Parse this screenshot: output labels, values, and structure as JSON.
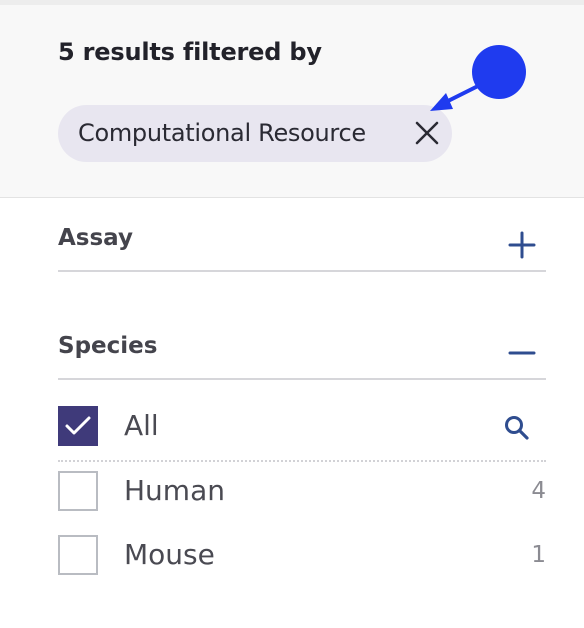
{
  "results_heading": "5 results filtered by",
  "active_filter": {
    "label": "Computational Resource",
    "remove_icon": "close-icon"
  },
  "annotation_color": "#1f3bef",
  "facets": {
    "assay": {
      "title": "Assay",
      "toggle_icon": "plus-icon",
      "expanded": false
    },
    "species": {
      "title": "Species",
      "toggle_icon": "minus-icon",
      "expanded": true,
      "search_icon": "search-icon",
      "options": [
        {
          "label": "All",
          "checked": true,
          "count": ""
        },
        {
          "label": "Human",
          "checked": false,
          "count": "4"
        },
        {
          "label": "Mouse",
          "checked": false,
          "count": "1"
        }
      ]
    }
  },
  "colors": {
    "accent": "#3f3a7a",
    "chip_bg": "#e8e6f0",
    "header_bg": "#f8f8f8",
    "icon_blue": "#2f4d8f"
  }
}
